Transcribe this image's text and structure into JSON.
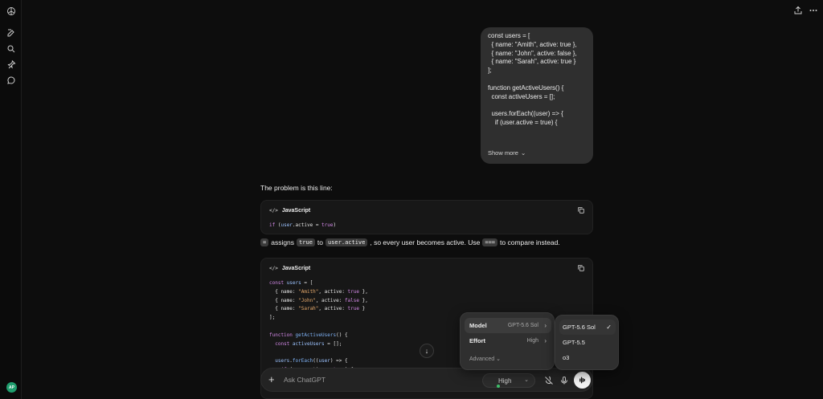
{
  "sidebar": {
    "avatar_initials": "AP",
    "icons": [
      "openai-logo-icon",
      "new-chat-icon",
      "search-icon",
      "pin-icon",
      "chat-bubble-icon"
    ]
  },
  "header": {
    "icons": [
      "share-icon",
      "more-options-icon"
    ]
  },
  "user_message": {
    "code": "const users = [\n  { name: \"Amith\", active: true },\n  { name: \"John\", active: false },\n  { name: \"Sarah\", active: true }\n];\n\nfunction getActiveUsers() {\n  const activeUsers = [];\n\n  users.forEach((user) => {\n    if (user.active = true) {",
    "show_more_label": "Show more"
  },
  "assistant": {
    "intro": "The problem is this line:",
    "code_block_1": {
      "language": "JavaScript",
      "code_line": "if (user.active = true)"
    },
    "explanation": {
      "code_eq": "=",
      "text_assigns": "assigns",
      "code_true": "true",
      "text_to": "to",
      "code_user_active": "user.active",
      "text_middle": ", so every user becomes active. Use",
      "code_strict": "===",
      "text_end": "to compare instead."
    },
    "code_block_2": {
      "language": "JavaScript"
    }
  },
  "composer": {
    "placeholder": "Ask ChatGPT",
    "effort_label": "High"
  },
  "model_menu": {
    "model_label": "Model",
    "model_value": "GPT-5.6 Sol",
    "effort_label": "Effort",
    "effort_value": "High",
    "advanced_label": "Advanced"
  },
  "model_submenu": {
    "options": [
      "GPT-5.6 Sol",
      "GPT-5.5",
      "o3"
    ],
    "selected": "GPT-5.6 Sol"
  },
  "colors": {
    "background": "#0d0d0d",
    "bubble": "#2f2f2f",
    "code_bg": "#171717",
    "keyword": "#d288e6",
    "string": "#e6a96b",
    "function": "#7fb3f7",
    "accent_green": "#3fbf6a"
  }
}
